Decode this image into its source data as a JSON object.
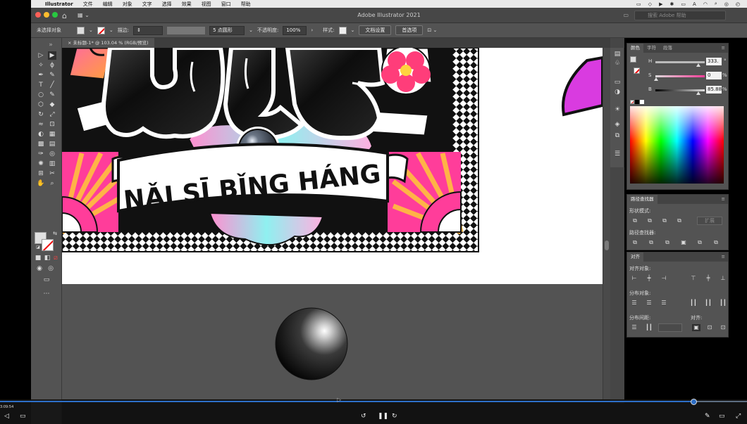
{
  "menubar": {
    "app_name": "Illustrator",
    "items": [
      "文件",
      "编辑",
      "对象",
      "文字",
      "选择",
      "效果",
      "视图",
      "窗口",
      "帮助"
    ]
  },
  "titlebar": {
    "title": "Adobe Illustrator 2021",
    "search_placeholder": "搜索 Adobe 帮助"
  },
  "control": {
    "no_selection": "未选择对象",
    "stroke_label": "描边:",
    "brush_label": "5 点圆形",
    "opacity_label": "不透明度:",
    "opacity_value": "100%",
    "style_label": "样式:",
    "doc_setup": "文档设置",
    "prefs": "首选项"
  },
  "doc_tab": {
    "label": "未标题-1* @ 103.04 % (RGB/预览)"
  },
  "artwork": {
    "banner_text": "NǍI SĪ BǏNG HÁNG",
    "colors": {
      "pink": "#ff3d9a",
      "orange": "#ff7b3a",
      "magenta": "#d93be0"
    }
  },
  "color_panel": {
    "tabs": [
      "颜色",
      "字符",
      "段落"
    ],
    "h_label": "H",
    "h_value": "333.",
    "s_label": "S",
    "s_value": "0",
    "b_label": "B",
    "b_value": "85.88",
    "pct": "%"
  },
  "pathfinder": {
    "title": "路径查找器",
    "shape_modes": "形状模式:",
    "expand": "扩展",
    "pathfinders": "路径查找器:"
  },
  "align": {
    "title": "对齐",
    "align_objects": "对齐对象:",
    "distribute_objects": "分布对象:",
    "distribute_spacing": "分布间距:",
    "align_to": "对齐:"
  },
  "player": {
    "time": "3:09:54",
    "progress": 0.929
  }
}
